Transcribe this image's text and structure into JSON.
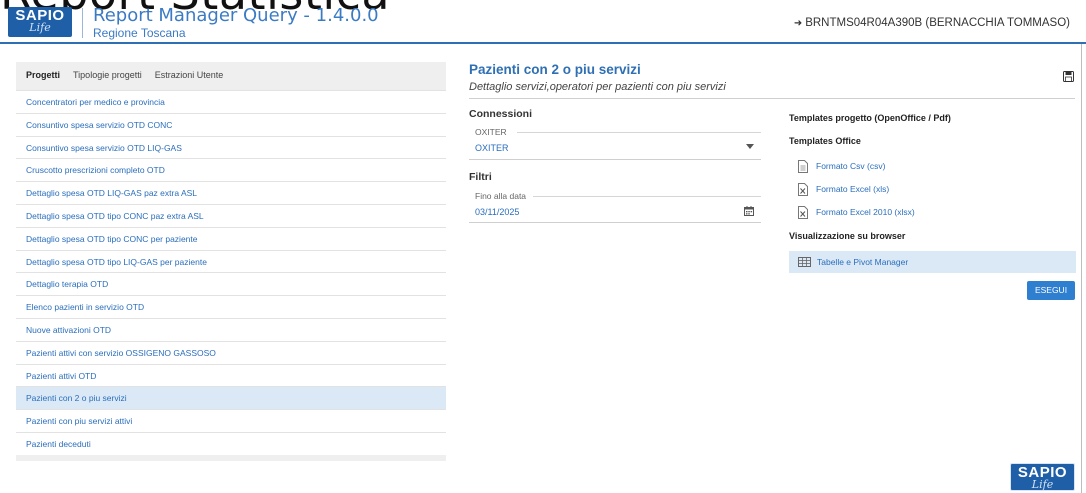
{
  "background_title": "Report Statistica",
  "header": {
    "logo": {
      "brand": "SAPIO",
      "sub": "Life"
    },
    "app_title": "Report Manager Query - 1.4.0.0",
    "app_subtitle": "Regione Toscana",
    "user": "BRNTMS04R04A390B (BERNACCHIA TOMMASO)",
    "user_icon": "sign-in-icon"
  },
  "tabs": [
    {
      "label": "Progetti",
      "active": true
    },
    {
      "label": "Tipologie progetti",
      "active": false
    },
    {
      "label": "Estrazioni Utente",
      "active": false
    }
  ],
  "projects": [
    {
      "label": "Concentratori per medico e provincia"
    },
    {
      "label": "Consuntivo spesa servizio OTD CONC"
    },
    {
      "label": "Consuntivo spesa servizio OTD LIQ-GAS"
    },
    {
      "label": "Cruscotto prescrizioni completo OTD"
    },
    {
      "label": "Dettaglio spesa OTD LIQ-GAS paz extra ASL"
    },
    {
      "label": "Dettaglio spesa OTD tipo CONC paz extra ASL"
    },
    {
      "label": "Dettaglio spesa OTD tipo CONC per paziente"
    },
    {
      "label": "Dettaglio spesa OTD tipo LIQ-GAS per paziente"
    },
    {
      "label": "Dettaglio terapia OTD"
    },
    {
      "label": "Elenco pazienti in servizio OTD"
    },
    {
      "label": "Nuove attivazioni OTD"
    },
    {
      "label": "Pazienti attivi con servizio OSSIGENO GASSOSO"
    },
    {
      "label": "Pazienti attivi OTD"
    },
    {
      "label": "Pazienti con 2 o piu servizi",
      "selected": true
    },
    {
      "label": "Pazienti con piu servizi attivi"
    },
    {
      "label": "Pazienti deceduti"
    }
  ],
  "report": {
    "title": "Pazienti con 2 o piu servizi",
    "description": "Dettaglio servizi,operatori per pazienti con piu servizi",
    "save_icon": "floppy-disk-icon"
  },
  "connessioni": {
    "heading": "Connessioni",
    "field_label": "OXITER",
    "value": "OXITER"
  },
  "filtri": {
    "heading": "Filtri",
    "field_label": "Fino alla data",
    "value": "03/11/2025"
  },
  "templates": {
    "project_heading": "Templates progetto (OpenOffice / Pdf)",
    "office_heading": "Templates Office",
    "office_items": [
      {
        "label": "Formato Csv (csv)",
        "icon": "csv-file-icon"
      },
      {
        "label": "Formato Excel (xls)",
        "icon": "excel-file-icon"
      },
      {
        "label": "Formato Excel 2010 (xlsx)",
        "icon": "excel-file-icon"
      }
    ],
    "browser_heading": "Visualizzazione su browser",
    "browser_item": {
      "label": "Tabelle e Pivot Manager",
      "icon": "table-icon"
    }
  },
  "run_button": "ESEGUI",
  "colors": {
    "accent": "#2f6fb4",
    "link": "#2a6ebc",
    "selected_row": "#dbe9f6",
    "button": "#2f7fd0",
    "logo_bg": "#1f5fa8"
  }
}
